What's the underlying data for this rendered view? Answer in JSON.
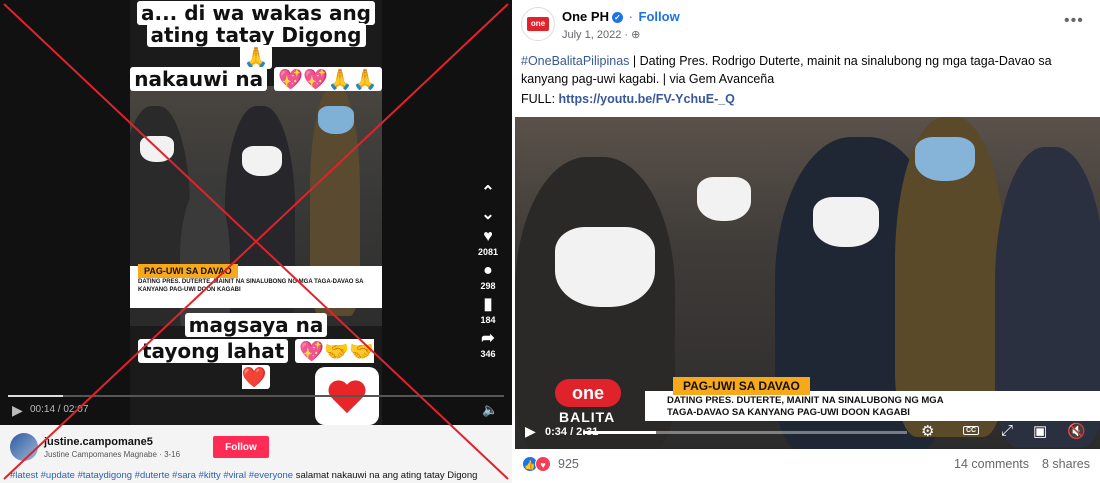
{
  "tiktok": {
    "caption_top_1": "a... di wa wakas ang",
    "caption_top_2": "ating tatay Digong",
    "caption_top_3": "nakauwi na",
    "caption_bottom_1": "magsaya na",
    "caption_bottom_2": "tayong lahat",
    "lower_third_tag": "PAG-UWI SA DAVAO",
    "lower_third_text": "DATING PRES. DUTERTE, MAINIT NA SINALUBONG NG MGA TAGA-DAVAO SA KANYANG PAG-UWI DOON KAGABI",
    "likes": "2081",
    "comments": "298",
    "saves": "184",
    "shares": "346",
    "time": "00:14 / 02:07",
    "username": "justine.campomane5",
    "subline": "Justine Campomanes Magnabe · 3-16",
    "follow_label": "Follow",
    "hashtags": "#latest #update #tataydigong #duterte #sara #kitty #viral #everyone",
    "description": " salamat nakauwi na ang ating tatay Digong",
    "progress": 0.11
  },
  "facebook": {
    "logo_text": "one Ph",
    "page_name": "One PH",
    "follow_label": "Follow",
    "date": "July 1, 2022 ·",
    "more": "•••",
    "hashtag": "#OneBalitaPilipinas",
    "post_text": " | Dating Pres. Rodrigo Duterte, mainit na sinalubong ng mga taga-Davao sa kanyang pag-uwi kagabi. | via Gem Avanceña",
    "full_label": "FULL: ",
    "full_link": "https://youtu.be/FV-YchuE-_Q",
    "lower_third_tag": "PAG-UWI SA DAVAO",
    "lower_third_line1": "DATING PRES. DUTERTE, MAINIT NA SINALUBONG NG MGA",
    "lower_third_line2": "TAGA-DAVAO SA KANYANG PAG-UWI DOON KAGABI",
    "brand_one": "one",
    "brand_balita": "BALITA",
    "video_time": "0:34 / 2:31",
    "progress": 0.225,
    "reaction_count": "925",
    "comments": "14 comments",
    "shares": "8 shares"
  },
  "colors": {
    "tiktok_follow": "#fe2c55",
    "fb_blue": "#1b74e4",
    "one_red": "#e0232a",
    "lower_third_orange": "#f7a81b",
    "x_mark": "#e0232a"
  }
}
